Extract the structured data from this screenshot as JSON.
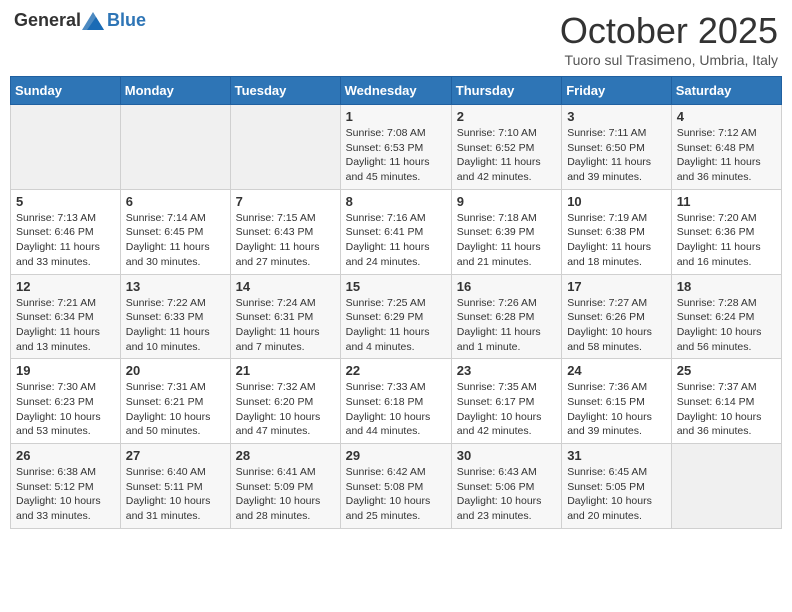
{
  "logo": {
    "general": "General",
    "blue": "Blue"
  },
  "header": {
    "month": "October 2025",
    "location": "Tuoro sul Trasimeno, Umbria, Italy"
  },
  "weekdays": [
    "Sunday",
    "Monday",
    "Tuesday",
    "Wednesday",
    "Thursday",
    "Friday",
    "Saturday"
  ],
  "weeks": [
    [
      {
        "day": "",
        "sunrise": "",
        "sunset": "",
        "daylight": ""
      },
      {
        "day": "",
        "sunrise": "",
        "sunset": "",
        "daylight": ""
      },
      {
        "day": "",
        "sunrise": "",
        "sunset": "",
        "daylight": ""
      },
      {
        "day": "1",
        "sunrise": "Sunrise: 7:08 AM",
        "sunset": "Sunset: 6:53 PM",
        "daylight": "Daylight: 11 hours and 45 minutes."
      },
      {
        "day": "2",
        "sunrise": "Sunrise: 7:10 AM",
        "sunset": "Sunset: 6:52 PM",
        "daylight": "Daylight: 11 hours and 42 minutes."
      },
      {
        "day": "3",
        "sunrise": "Sunrise: 7:11 AM",
        "sunset": "Sunset: 6:50 PM",
        "daylight": "Daylight: 11 hours and 39 minutes."
      },
      {
        "day": "4",
        "sunrise": "Sunrise: 7:12 AM",
        "sunset": "Sunset: 6:48 PM",
        "daylight": "Daylight: 11 hours and 36 minutes."
      }
    ],
    [
      {
        "day": "5",
        "sunrise": "Sunrise: 7:13 AM",
        "sunset": "Sunset: 6:46 PM",
        "daylight": "Daylight: 11 hours and 33 minutes."
      },
      {
        "day": "6",
        "sunrise": "Sunrise: 7:14 AM",
        "sunset": "Sunset: 6:45 PM",
        "daylight": "Daylight: 11 hours and 30 minutes."
      },
      {
        "day": "7",
        "sunrise": "Sunrise: 7:15 AM",
        "sunset": "Sunset: 6:43 PM",
        "daylight": "Daylight: 11 hours and 27 minutes."
      },
      {
        "day": "8",
        "sunrise": "Sunrise: 7:16 AM",
        "sunset": "Sunset: 6:41 PM",
        "daylight": "Daylight: 11 hours and 24 minutes."
      },
      {
        "day": "9",
        "sunrise": "Sunrise: 7:18 AM",
        "sunset": "Sunset: 6:39 PM",
        "daylight": "Daylight: 11 hours and 21 minutes."
      },
      {
        "day": "10",
        "sunrise": "Sunrise: 7:19 AM",
        "sunset": "Sunset: 6:38 PM",
        "daylight": "Daylight: 11 hours and 18 minutes."
      },
      {
        "day": "11",
        "sunrise": "Sunrise: 7:20 AM",
        "sunset": "Sunset: 6:36 PM",
        "daylight": "Daylight: 11 hours and 16 minutes."
      }
    ],
    [
      {
        "day": "12",
        "sunrise": "Sunrise: 7:21 AM",
        "sunset": "Sunset: 6:34 PM",
        "daylight": "Daylight: 11 hours and 13 minutes."
      },
      {
        "day": "13",
        "sunrise": "Sunrise: 7:22 AM",
        "sunset": "Sunset: 6:33 PM",
        "daylight": "Daylight: 11 hours and 10 minutes."
      },
      {
        "day": "14",
        "sunrise": "Sunrise: 7:24 AM",
        "sunset": "Sunset: 6:31 PM",
        "daylight": "Daylight: 11 hours and 7 minutes."
      },
      {
        "day": "15",
        "sunrise": "Sunrise: 7:25 AM",
        "sunset": "Sunset: 6:29 PM",
        "daylight": "Daylight: 11 hours and 4 minutes."
      },
      {
        "day": "16",
        "sunrise": "Sunrise: 7:26 AM",
        "sunset": "Sunset: 6:28 PM",
        "daylight": "Daylight: 11 hours and 1 minute."
      },
      {
        "day": "17",
        "sunrise": "Sunrise: 7:27 AM",
        "sunset": "Sunset: 6:26 PM",
        "daylight": "Daylight: 10 hours and 58 minutes."
      },
      {
        "day": "18",
        "sunrise": "Sunrise: 7:28 AM",
        "sunset": "Sunset: 6:24 PM",
        "daylight": "Daylight: 10 hours and 56 minutes."
      }
    ],
    [
      {
        "day": "19",
        "sunrise": "Sunrise: 7:30 AM",
        "sunset": "Sunset: 6:23 PM",
        "daylight": "Daylight: 10 hours and 53 minutes."
      },
      {
        "day": "20",
        "sunrise": "Sunrise: 7:31 AM",
        "sunset": "Sunset: 6:21 PM",
        "daylight": "Daylight: 10 hours and 50 minutes."
      },
      {
        "day": "21",
        "sunrise": "Sunrise: 7:32 AM",
        "sunset": "Sunset: 6:20 PM",
        "daylight": "Daylight: 10 hours and 47 minutes."
      },
      {
        "day": "22",
        "sunrise": "Sunrise: 7:33 AM",
        "sunset": "Sunset: 6:18 PM",
        "daylight": "Daylight: 10 hours and 44 minutes."
      },
      {
        "day": "23",
        "sunrise": "Sunrise: 7:35 AM",
        "sunset": "Sunset: 6:17 PM",
        "daylight": "Daylight: 10 hours and 42 minutes."
      },
      {
        "day": "24",
        "sunrise": "Sunrise: 7:36 AM",
        "sunset": "Sunset: 6:15 PM",
        "daylight": "Daylight: 10 hours and 39 minutes."
      },
      {
        "day": "25",
        "sunrise": "Sunrise: 7:37 AM",
        "sunset": "Sunset: 6:14 PM",
        "daylight": "Daylight: 10 hours and 36 minutes."
      }
    ],
    [
      {
        "day": "26",
        "sunrise": "Sunrise: 6:38 AM",
        "sunset": "Sunset: 5:12 PM",
        "daylight": "Daylight: 10 hours and 33 minutes."
      },
      {
        "day": "27",
        "sunrise": "Sunrise: 6:40 AM",
        "sunset": "Sunset: 5:11 PM",
        "daylight": "Daylight: 10 hours and 31 minutes."
      },
      {
        "day": "28",
        "sunrise": "Sunrise: 6:41 AM",
        "sunset": "Sunset: 5:09 PM",
        "daylight": "Daylight: 10 hours and 28 minutes."
      },
      {
        "day": "29",
        "sunrise": "Sunrise: 6:42 AM",
        "sunset": "Sunset: 5:08 PM",
        "daylight": "Daylight: 10 hours and 25 minutes."
      },
      {
        "day": "30",
        "sunrise": "Sunrise: 6:43 AM",
        "sunset": "Sunset: 5:06 PM",
        "daylight": "Daylight: 10 hours and 23 minutes."
      },
      {
        "day": "31",
        "sunrise": "Sunrise: 6:45 AM",
        "sunset": "Sunset: 5:05 PM",
        "daylight": "Daylight: 10 hours and 20 minutes."
      },
      {
        "day": "",
        "sunrise": "",
        "sunset": "",
        "daylight": ""
      }
    ]
  ]
}
